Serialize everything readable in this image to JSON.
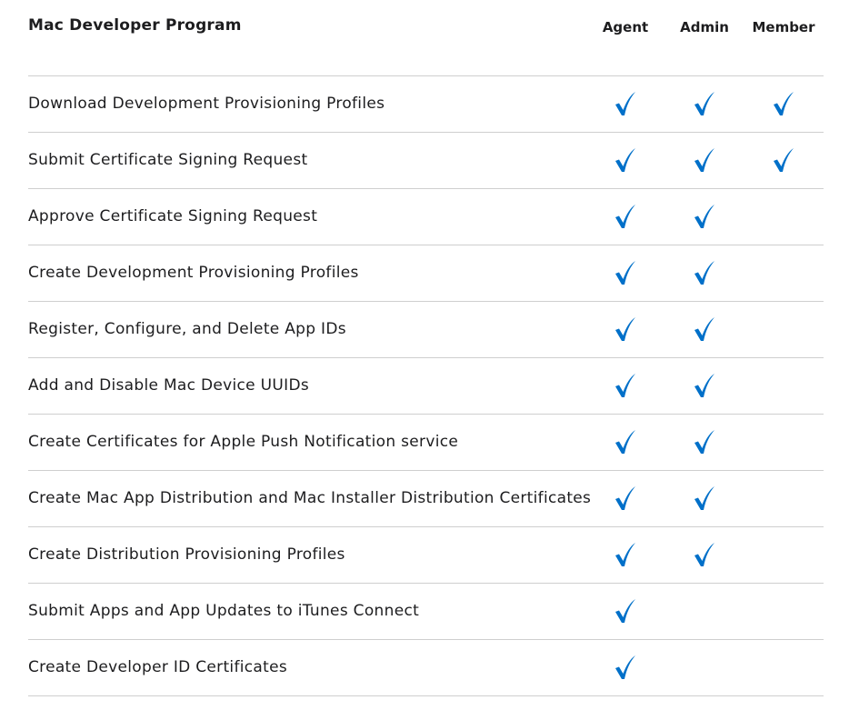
{
  "title": "Mac Developer Program",
  "columns": [
    "Agent",
    "Admin",
    "Member"
  ],
  "colors": {
    "check": "#0070c9",
    "divider": "#cfcfcf",
    "text": "#1d1d1f"
  },
  "icons": {
    "check": "checkmark-icon"
  },
  "rows": [
    {
      "label": "Download Development Provisioning Profiles",
      "agent": true,
      "admin": true,
      "member": true
    },
    {
      "label": "Submit Certificate Signing Request",
      "agent": true,
      "admin": true,
      "member": true
    },
    {
      "label": "Approve Certificate Signing Request",
      "agent": true,
      "admin": true,
      "member": false
    },
    {
      "label": "Create Development Provisioning Profiles",
      "agent": true,
      "admin": true,
      "member": false
    },
    {
      "label": "Register, Configure, and Delete App IDs",
      "agent": true,
      "admin": true,
      "member": false
    },
    {
      "label": "Add and Disable Mac Device UUIDs",
      "agent": true,
      "admin": true,
      "member": false
    },
    {
      "label": "Create Certificates for Apple Push Notification service",
      "agent": true,
      "admin": true,
      "member": false
    },
    {
      "label": "Create Mac App Distribution and Mac Installer Distribution Certificates",
      "agent": true,
      "admin": true,
      "member": false
    },
    {
      "label": "Create Distribution Provisioning Profiles",
      "agent": true,
      "admin": true,
      "member": false
    },
    {
      "label": "Submit Apps and App Updates to iTunes Connect",
      "agent": true,
      "admin": false,
      "member": false
    },
    {
      "label": "Create Developer ID Certificates",
      "agent": true,
      "admin": false,
      "member": false
    }
  ]
}
